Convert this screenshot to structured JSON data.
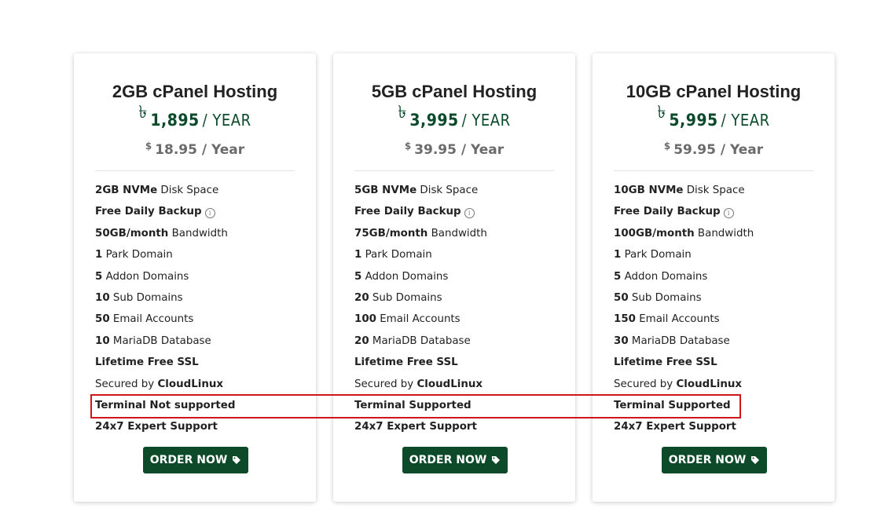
{
  "currency_symbol": "৳",
  "usd_symbol": "$",
  "order_label": "ORDER NOW",
  "plans": [
    {
      "title": "2GB cPanel Hosting",
      "price_bdt": "1,895",
      "price_bdt_period": "/ YEAR",
      "price_usd": "18.95",
      "price_usd_period": "/ Year",
      "features": {
        "disk": {
          "bold": "2GB NVMe",
          "text": " Disk Space"
        },
        "backup": {
          "bold": "Free Daily Backup"
        },
        "bandwidth": {
          "bold": "50GB/month",
          "text": " Bandwidth"
        },
        "park": {
          "bold": "1",
          "text": " Park Domain"
        },
        "addon": {
          "bold": "5",
          "text": " Addon Domains"
        },
        "sub": {
          "bold": "10",
          "text": " Sub Domains"
        },
        "email": {
          "bold": "50",
          "text": " Email Accounts"
        },
        "db": {
          "bold": "10",
          "text": " MariaDB Database"
        },
        "ssl": {
          "bold": "Lifetime Free SSL"
        },
        "secured": {
          "text": "Secured by ",
          "bold": "CloudLinux"
        },
        "terminal": {
          "bold": "Terminal Not supported"
        },
        "support": {
          "bold": "24x7 Expert Support"
        }
      }
    },
    {
      "title": "5GB cPanel Hosting",
      "price_bdt": "3,995",
      "price_bdt_period": "/ YEAR",
      "price_usd": "39.95",
      "price_usd_period": "/ Year",
      "features": {
        "disk": {
          "bold": "5GB NVMe",
          "text": " Disk Space"
        },
        "backup": {
          "bold": "Free Daily Backup"
        },
        "bandwidth": {
          "bold": "75GB/month",
          "text": " Bandwidth"
        },
        "park": {
          "bold": "1",
          "text": " Park Domain"
        },
        "addon": {
          "bold": "5",
          "text": " Addon Domains"
        },
        "sub": {
          "bold": "20",
          "text": " Sub Domains"
        },
        "email": {
          "bold": "100",
          "text": " Email Accounts"
        },
        "db": {
          "bold": "20",
          "text": " MariaDB Database"
        },
        "ssl": {
          "bold": "Lifetime Free SSL"
        },
        "secured": {
          "text": "Secured by ",
          "bold": "CloudLinux"
        },
        "terminal": {
          "bold": "Terminal Supported"
        },
        "support": {
          "bold": "24x7 Expert Support"
        }
      }
    },
    {
      "title": "10GB cPanel Hosting",
      "price_bdt": "5,995",
      "price_bdt_period": "/ YEAR",
      "price_usd": "59.95",
      "price_usd_period": "/ Year",
      "features": {
        "disk": {
          "bold": "10GB NVMe",
          "text": " Disk Space"
        },
        "backup": {
          "bold": "Free Daily Backup"
        },
        "bandwidth": {
          "bold": "100GB/month",
          "text": " Bandwidth"
        },
        "park": {
          "bold": "1",
          "text": " Park Domain"
        },
        "addon": {
          "bold": "5",
          "text": " Addon Domains"
        },
        "sub": {
          "bold": "50",
          "text": " Sub Domains"
        },
        "email": {
          "bold": "150",
          "text": " Email Accounts"
        },
        "db": {
          "bold": "30",
          "text": " MariaDB Database"
        },
        "ssl": {
          "bold": "Lifetime Free SSL"
        },
        "secured": {
          "text": "Secured by ",
          "bold": "CloudLinux"
        },
        "terminal": {
          "bold": "Terminal Supported"
        },
        "support": {
          "bold": "24x7 Expert Support"
        }
      }
    }
  ],
  "colors": {
    "brand_green": "#0c4a2a",
    "highlight_red": "#d0161b",
    "usd_gray": "#6b6b6b"
  },
  "icons": {
    "info": "info-icon",
    "tag": "tag-icon"
  }
}
